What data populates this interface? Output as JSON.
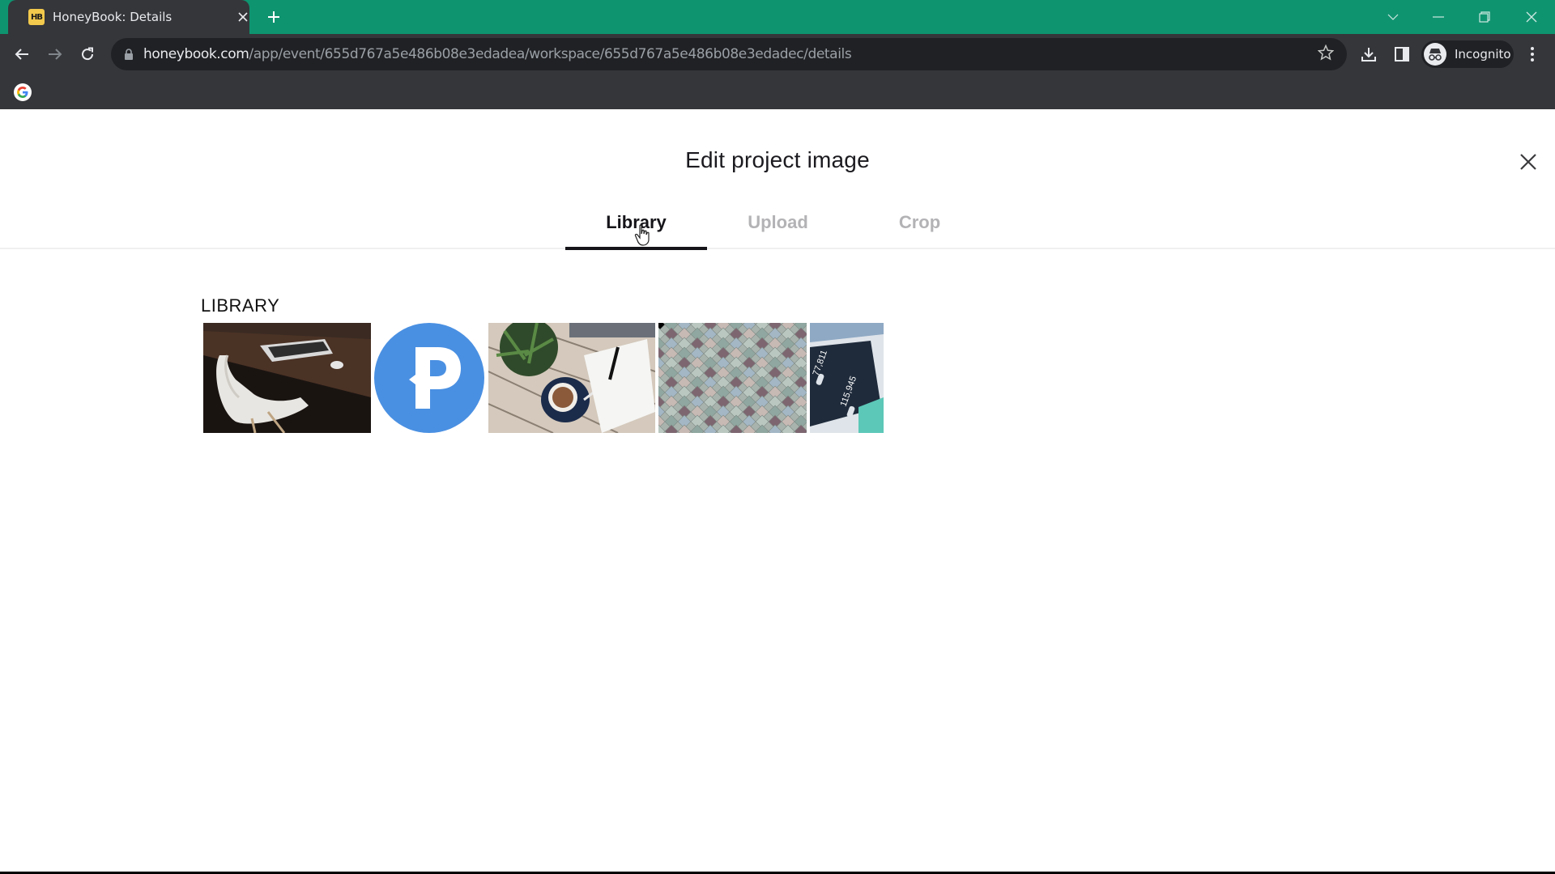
{
  "browser": {
    "tab_title": "HoneyBook: Details",
    "tab_favicon_text": "HB",
    "url_host": "honeybook.com",
    "url_path": "/app/event/655d767a5e486b08e3edadea/workspace/655d767a5e486b08e3edadec/details",
    "profile_label": "Incognito",
    "accent_color": "#0f9470",
    "icons": {
      "back": "arrow-left-icon",
      "forward": "arrow-right-icon",
      "reload": "reload-icon",
      "lock": "lock-icon",
      "bookmark": "star-icon",
      "download": "download-icon",
      "side_panel": "side-panel-icon",
      "profile": "incognito-icon",
      "menu": "kebab-menu-icon",
      "bookmark_google": "google-icon"
    }
  },
  "modal": {
    "title": "Edit project image",
    "tabs": [
      {
        "label": "Library",
        "active": true
      },
      {
        "label": "Upload",
        "active": false
      },
      {
        "label": "Crop",
        "active": false
      }
    ],
    "section_label": "LIBRARY",
    "library_images": [
      {
        "description": "Laptop on wooden desk with white chair"
      },
      {
        "description": "Blue circle with white P logo"
      },
      {
        "description": "Plant, latte and notebook with pen on wooden table"
      },
      {
        "description": "Pastel colored scale tiles pattern"
      },
      {
        "description": "Phone screen showing statistics"
      }
    ]
  }
}
